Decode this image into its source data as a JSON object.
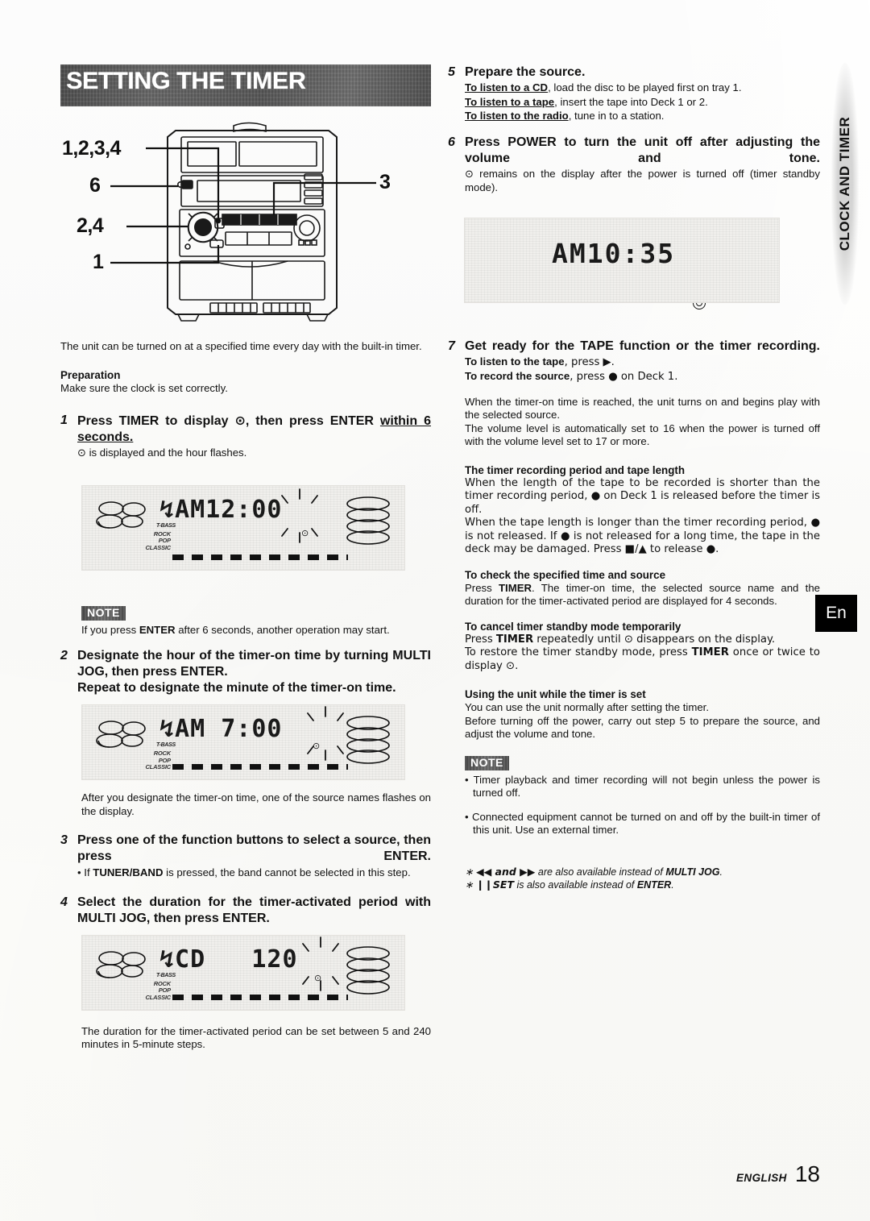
{
  "header": {
    "banner_title": "SETTING THE TIMER",
    "side_tab_label": "CLOCK AND TIMER",
    "lang_tab": "En"
  },
  "diagram": {
    "callouts": [
      {
        "label": "1,2,3,4"
      },
      {
        "label": "6"
      },
      {
        "label": "2,4"
      },
      {
        "label": "1"
      },
      {
        "label": "3"
      }
    ]
  },
  "left": {
    "intro": "The unit can be turned on at a specified time every day with the built-in timer.",
    "preparation_head": "Preparation",
    "preparation_text": "Make sure the clock is set correctly.",
    "step1": {
      "num": "1",
      "title_a": "Press TIMER to display ",
      "title_clock": "⊙",
      "title_b": ", then press ENTER ",
      "title_underline": "within 6 seconds.",
      "sub": " is displayed and the hour flashes."
    },
    "note1_badge": "NOTE",
    "note1_text_a": "If you press ",
    "note1_bold": "ENTER",
    "note1_text_b": " after 6 seconds, another operation may start.",
    "step2": {
      "num": "2",
      "line1": "Designate the hour of the timer-on time by turning MULTI JOG, then press ENTER.",
      "line2": "Repeat to designate the minute of the timer-on time."
    },
    "after_step2": "After you designate the timer-on time, one of the source names flashes on the display.",
    "step3": {
      "num": "3",
      "title": "Press one of the function buttons to select a source, then press ENTER.",
      "bullet_a": "• If ",
      "bullet_bold": "TUNER/BAND",
      "bullet_b": " is pressed, the band cannot be selected in this step."
    },
    "step4": {
      "num": "4",
      "title": "Select the duration for the timer-activated period with MULTI JOG, then press ENTER."
    },
    "after_step4": "The duration for the timer-activated period can be set between 5 and 240 minutes in 5-minute steps."
  },
  "displays": {
    "d1": {
      "text": "↯AM12:00",
      "tbass": "T-BASS",
      "eq": [
        "ROCK",
        "POP",
        "CLASSIC"
      ]
    },
    "d2": {
      "text": "↯AM 7:00",
      "tbass": "T-BASS",
      "eq": [
        "ROCK",
        "POP",
        "CLASSIC"
      ]
    },
    "d3": {
      "text": "↯CD   120",
      "tbass": "T-BASS",
      "eq": [
        "ROCK",
        "POP",
        "CLASSIC"
      ]
    },
    "d4": {
      "text": "AM10:35"
    }
  },
  "right": {
    "step5": {
      "num": "5",
      "title": "Prepare the source.",
      "l1_u": "To listen to a CD",
      "l1_t": ", load the disc to be played first on tray 1.",
      "l2_u": "To listen to a tape",
      "l2_t": ", insert the tape into Deck 1 or 2.",
      "l3_u": "To listen to the radio",
      "l3_t": ", tune in to a station."
    },
    "step6": {
      "num": "6",
      "title": "Press POWER to turn the unit off after adjusting the volume and tone.",
      "sub": " remains on the display after the power is turned off (timer standby mode)."
    },
    "step7": {
      "num": "7",
      "title": "Get ready for the TAPE function or the timer recording.",
      "l1_b": "To listen to the tape",
      "l1_t": ", press ▶.",
      "l2_b": "To record the source",
      "l2_t": ", press ● on Deck 1."
    },
    "after7_p1": "When the timer-on time is reached, the unit turns on and begins play with the selected source.",
    "after7_p2": "The volume level is automatically set to 16 when the power is turned off with the volume level set to 17 or more.",
    "sec1_head": "The timer recording period and tape length",
    "sec1_p1": "When the length of the tape to be recorded is shorter than the timer recording period, ● on Deck 1 is released before the timer is off.",
    "sec1_p2": "When the tape length is longer than the timer recording period, ● is not released.  If ● is not released for a long time, the tape in the deck may be damaged.  Press ■/▲ to release ●.",
    "sec2_head": "To check the specified time and source",
    "sec2_p1_a": "Press ",
    "sec2_p1_b": "TIMER",
    "sec2_p1_c": ". The timer-on time, the selected source name and the duration for the timer-activated period are displayed for 4 seconds.",
    "sec3_head": "To cancel timer standby mode temporarily",
    "sec3_p1_a": "Press ",
    "sec3_p1_b": "TIMER",
    "sec3_p1_c": " repeatedly until ⊙ disappears on the display.",
    "sec3_p2_a": "To restore the timer standby mode, press ",
    "sec3_p2_b": "TIMER",
    "sec3_p2_c": " once or twice to display ⊙.",
    "sec4_head": "Using the unit while the timer is set",
    "sec4_p1": "You can use the unit normally after setting the timer.",
    "sec4_p2": "Before turning off the power, carry out step 5 to prepare the source, and adjust the volume and tone.",
    "note2_badge": "NOTE",
    "note2_b1": "• Timer playback and timer recording will not begin unless the power is turned off.",
    "note2_b2": "• Connected equipment cannot be turned on and off by the built-in timer of this unit.  Use an external timer.",
    "foot1_a": "∗ ",
    "foot1_sym": "◀◀ and ▶▶",
    "foot1_b": " are also available instead of ",
    "foot1_bold": "MULTI JOG",
    "foot1_c": ".",
    "foot2_a": "∗ ",
    "foot2_bold": "❙❙SET",
    "foot2_b": " is also available instead of ",
    "foot2_bold2": "ENTER",
    "foot2_c": "."
  },
  "footer": {
    "language": "ENGLISH",
    "page_number": "18"
  }
}
